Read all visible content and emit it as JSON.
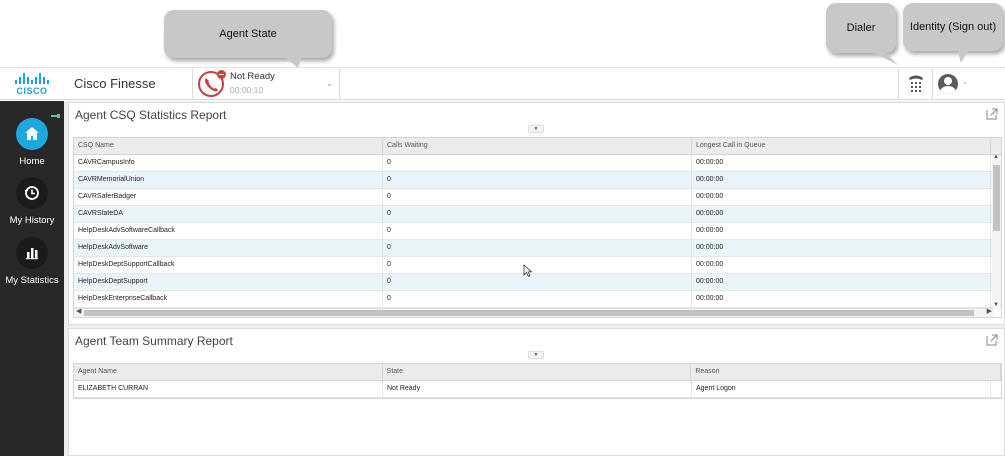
{
  "callouts": {
    "agent_state": "Agent State",
    "dialer": "Dialer",
    "identity": "Identity (Sign out)"
  },
  "header": {
    "logo_text": "CISCO",
    "app_name": "Cisco Finesse",
    "state_label": "Not Ready",
    "state_timer": "00:00:10"
  },
  "sidebar": {
    "items": [
      {
        "label": "Home",
        "icon": "home-icon",
        "active": true
      },
      {
        "label": "My History",
        "icon": "history-icon",
        "active": false
      },
      {
        "label": "My Statistics",
        "icon": "statistics-icon",
        "active": false
      }
    ]
  },
  "csq_report": {
    "title": "Agent CSQ Statistics Report",
    "columns": [
      "CSQ Name",
      "Calls Waiting",
      "Longest Call in Queue"
    ],
    "rows": [
      [
        "CAVRCampusInfo",
        "0",
        "00:00:00"
      ],
      [
        "CAVRMemorialUnion",
        "0",
        "00:00:00"
      ],
      [
        "CAVRSaferBadger",
        "0",
        "00:00:00"
      ],
      [
        "CAVRStateDA",
        "0",
        "00:00:00"
      ],
      [
        "HelpDeskAdvSoftwareCallback",
        "0",
        "00:00:00"
      ],
      [
        "HelpDeskAdvSoftware",
        "0",
        "00:00:00"
      ],
      [
        "HelpDeskDeptSupportCallback",
        "0",
        "00:00:00"
      ],
      [
        "HelpDeskDeptSupport",
        "0",
        "00:00:00"
      ],
      [
        "HelpDeskEnterpriseCallback",
        "0",
        "00:00:00"
      ]
    ]
  },
  "team_report": {
    "title": "Agent Team Summary Report",
    "columns": [
      "Agent Name",
      "State",
      "Reason"
    ],
    "rows": [
      [
        "ELIZABETH CURRAN",
        "Not Ready",
        "Agent Logon"
      ]
    ]
  },
  "colors": {
    "accent": "#1fa8e0",
    "not_ready": "#c94040",
    "sidebar_bg": "#282828",
    "row_alt": "#eaf4fb"
  }
}
